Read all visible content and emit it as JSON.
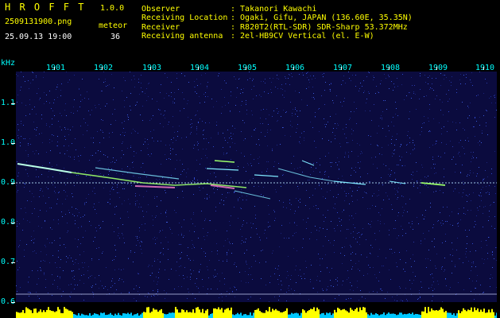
{
  "header": {
    "app_name": "H R O F F T",
    "version": "1.0.0",
    "filename": "2509131900.png",
    "mode": "meteor",
    "datetime": "25.09.13 19:00",
    "count": "36",
    "fields": [
      {
        "label": "Observer",
        "value": ": Takanori Kawachi"
      },
      {
        "label": "Receiving Location",
        "value": ": Ogaki, Gifu, JAPAN (136.60E, 35.35N)"
      },
      {
        "label": "Receiver",
        "value": ": R820T2(RTL-SDR) SDR-Sharp 53.372MHz"
      },
      {
        "label": "Receiving antenna",
        "value": ": 2el-HB9CV Vertical (el. E-W)"
      }
    ]
  },
  "axes": {
    "y_unit": "kHz",
    "x_ticks": [
      "1901",
      "1902",
      "1903",
      "1904",
      "1905",
      "1906",
      "1907",
      "1908",
      "1909",
      "1910"
    ],
    "y_ticks": [
      "1.1",
      "1.0",
      "0.9",
      "0.8",
      "0.7",
      "0.6"
    ]
  },
  "colors": {
    "background": "#000000",
    "header_yellow": "#ffff00",
    "header_white": "#ffffff",
    "axis_cyan": "#00ffff",
    "spectrogram_bg": "#0b0b3e",
    "noise_blue": "#2a3aa8",
    "trail_cyan": "#7fe8ff",
    "trail_green": "#9cff6a",
    "trail_magenta": "#ff7fd0",
    "bottom_bar_cyan": "#00c8ff",
    "bottom_bar_yellow": "#ffff00"
  }
}
